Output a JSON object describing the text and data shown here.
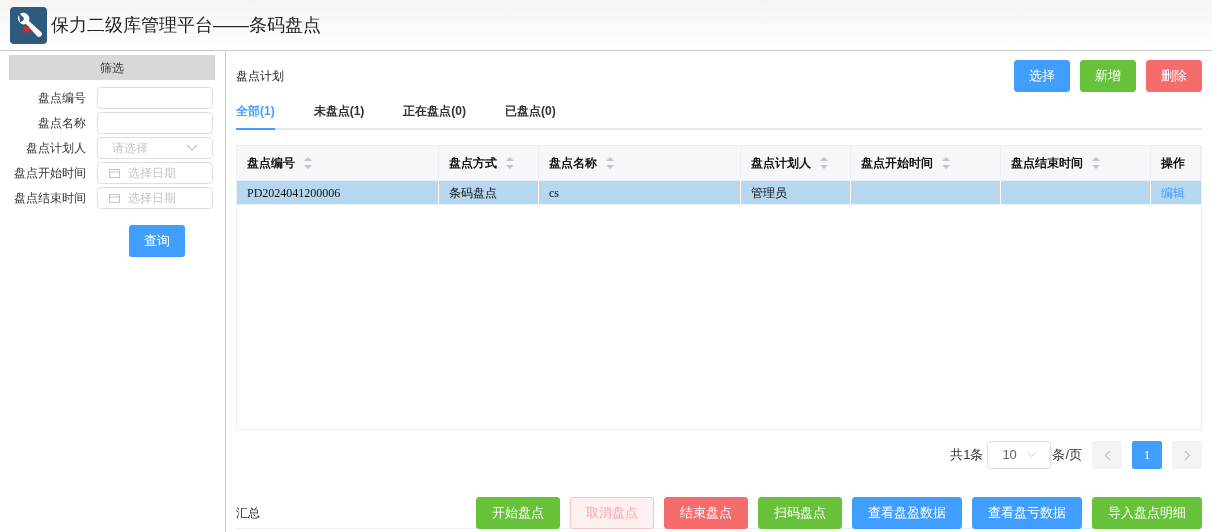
{
  "header": {
    "title": "保力二级库管理平台——条码盘点"
  },
  "filter": {
    "title": "筛选",
    "fields": [
      {
        "kind": "text",
        "label": "盘点编号"
      },
      {
        "kind": "text",
        "label": "盘点名称"
      },
      {
        "kind": "select",
        "label": "盘点计划人",
        "placeholder": "请选择"
      },
      {
        "kind": "date",
        "label": "盘点开始时间",
        "placeholder": "选择日期"
      },
      {
        "kind": "date",
        "label": "盘点结束时间",
        "placeholder": "选择日期"
      }
    ],
    "query_button": "查询"
  },
  "panel": {
    "title": "盘点计划",
    "buttons": [
      {
        "label": "选择",
        "kind": "primary",
        "disabled": false
      },
      {
        "label": "新增",
        "kind": "success",
        "disabled": false
      },
      {
        "label": "删除",
        "kind": "danger",
        "disabled": false
      }
    ]
  },
  "tabs": [
    {
      "label": "全部(1)",
      "selected": true
    },
    {
      "label": "未盘点(1)",
      "selected": false
    },
    {
      "label": "正在盘点(0)",
      "selected": false
    },
    {
      "label": "已盘点(0)",
      "selected": false
    }
  ],
  "table": {
    "columns": [
      {
        "label": "盘点编号",
        "sortable": true
      },
      {
        "label": "盘点方式",
        "sortable": true
      },
      {
        "label": "盘点名称",
        "sortable": true
      },
      {
        "label": "盘点计划人",
        "sortable": true
      },
      {
        "label": "盘点开始时间",
        "sortable": true
      },
      {
        "label": "盘点结束时间",
        "sortable": true
      },
      {
        "label": "操作",
        "sortable": false
      }
    ],
    "rows": [
      {
        "selected": true,
        "cells": [
          "PD2024041200006",
          "条码盘点",
          "cs",
          "管理员",
          "",
          ""
        ],
        "action": "编辑"
      }
    ]
  },
  "pagination": {
    "total": "共1条",
    "page_size": "10",
    "per_page": "条/页",
    "pages": [
      {
        "label": "1",
        "selected": true
      }
    ],
    "prev_disabled": true,
    "next_disabled": true
  },
  "footer": {
    "label": "汇总",
    "buttons": [
      {
        "label": "开始盘点",
        "kind": "success",
        "disabled": false
      },
      {
        "label": "取消盘点",
        "kind": "danger",
        "disabled": true
      },
      {
        "label": "结束盘点",
        "kind": "danger",
        "disabled": false
      },
      {
        "label": "扫码盘点",
        "kind": "success",
        "disabled": false
      },
      {
        "label": "查看盘盈数据",
        "kind": "primary",
        "disabled": false
      },
      {
        "label": "查看盘亏数据",
        "kind": "primary",
        "disabled": false
      },
      {
        "label": "导入盘点明细",
        "kind": "success",
        "disabled": false
      }
    ]
  }
}
